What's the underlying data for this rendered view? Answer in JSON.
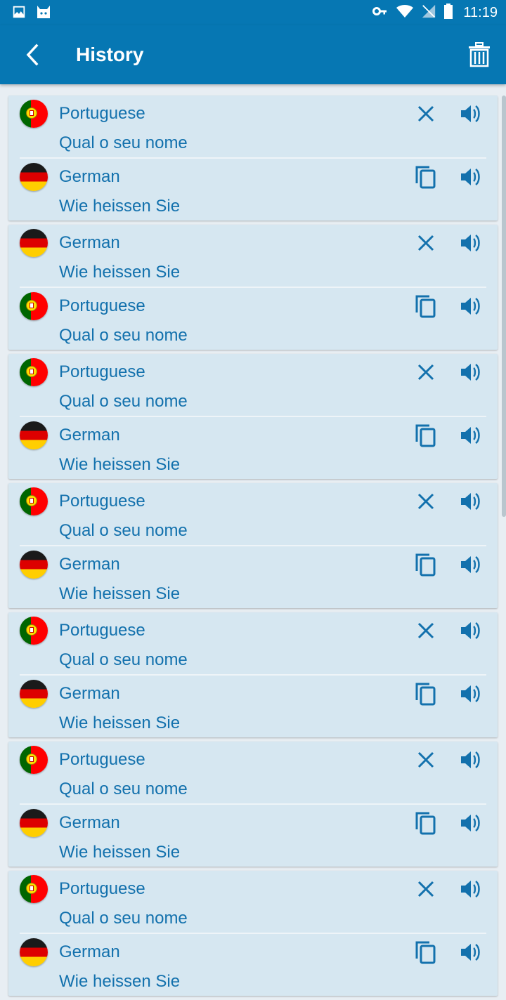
{
  "status_bar": {
    "time": "11:19"
  },
  "header": {
    "title": "History"
  },
  "colors": {
    "primary": "#0677b3",
    "card": "#d6e7f1",
    "text": "#1371ad"
  },
  "history": [
    {
      "from": {
        "lang": "Portuguese",
        "text": "Qual o seu nome",
        "flag": "pt"
      },
      "to": {
        "lang": "German",
        "text": "Wie heissen Sie",
        "flag": "de"
      }
    },
    {
      "from": {
        "lang": "German",
        "text": "Wie heissen Sie",
        "flag": "de"
      },
      "to": {
        "lang": "Portuguese",
        "text": "Qual o seu nome",
        "flag": "pt"
      }
    },
    {
      "from": {
        "lang": "Portuguese",
        "text": "Qual o seu nome",
        "flag": "pt"
      },
      "to": {
        "lang": "German",
        "text": "Wie heissen Sie",
        "flag": "de"
      }
    },
    {
      "from": {
        "lang": "Portuguese",
        "text": "Qual o seu nome",
        "flag": "pt"
      },
      "to": {
        "lang": "German",
        "text": "Wie heissen Sie",
        "flag": "de"
      }
    },
    {
      "from": {
        "lang": "Portuguese",
        "text": "Qual o seu nome",
        "flag": "pt"
      },
      "to": {
        "lang": "German",
        "text": "Wie heissen Sie",
        "flag": "de"
      }
    },
    {
      "from": {
        "lang": "Portuguese",
        "text": "Qual o seu nome",
        "flag": "pt"
      },
      "to": {
        "lang": "German",
        "text": "Wie heissen Sie",
        "flag": "de"
      }
    },
    {
      "from": {
        "lang": "Portuguese",
        "text": "Qual o seu nome",
        "flag": "pt"
      },
      "to": {
        "lang": "German",
        "text": "Wie heissen Sie",
        "flag": "de"
      }
    }
  ]
}
